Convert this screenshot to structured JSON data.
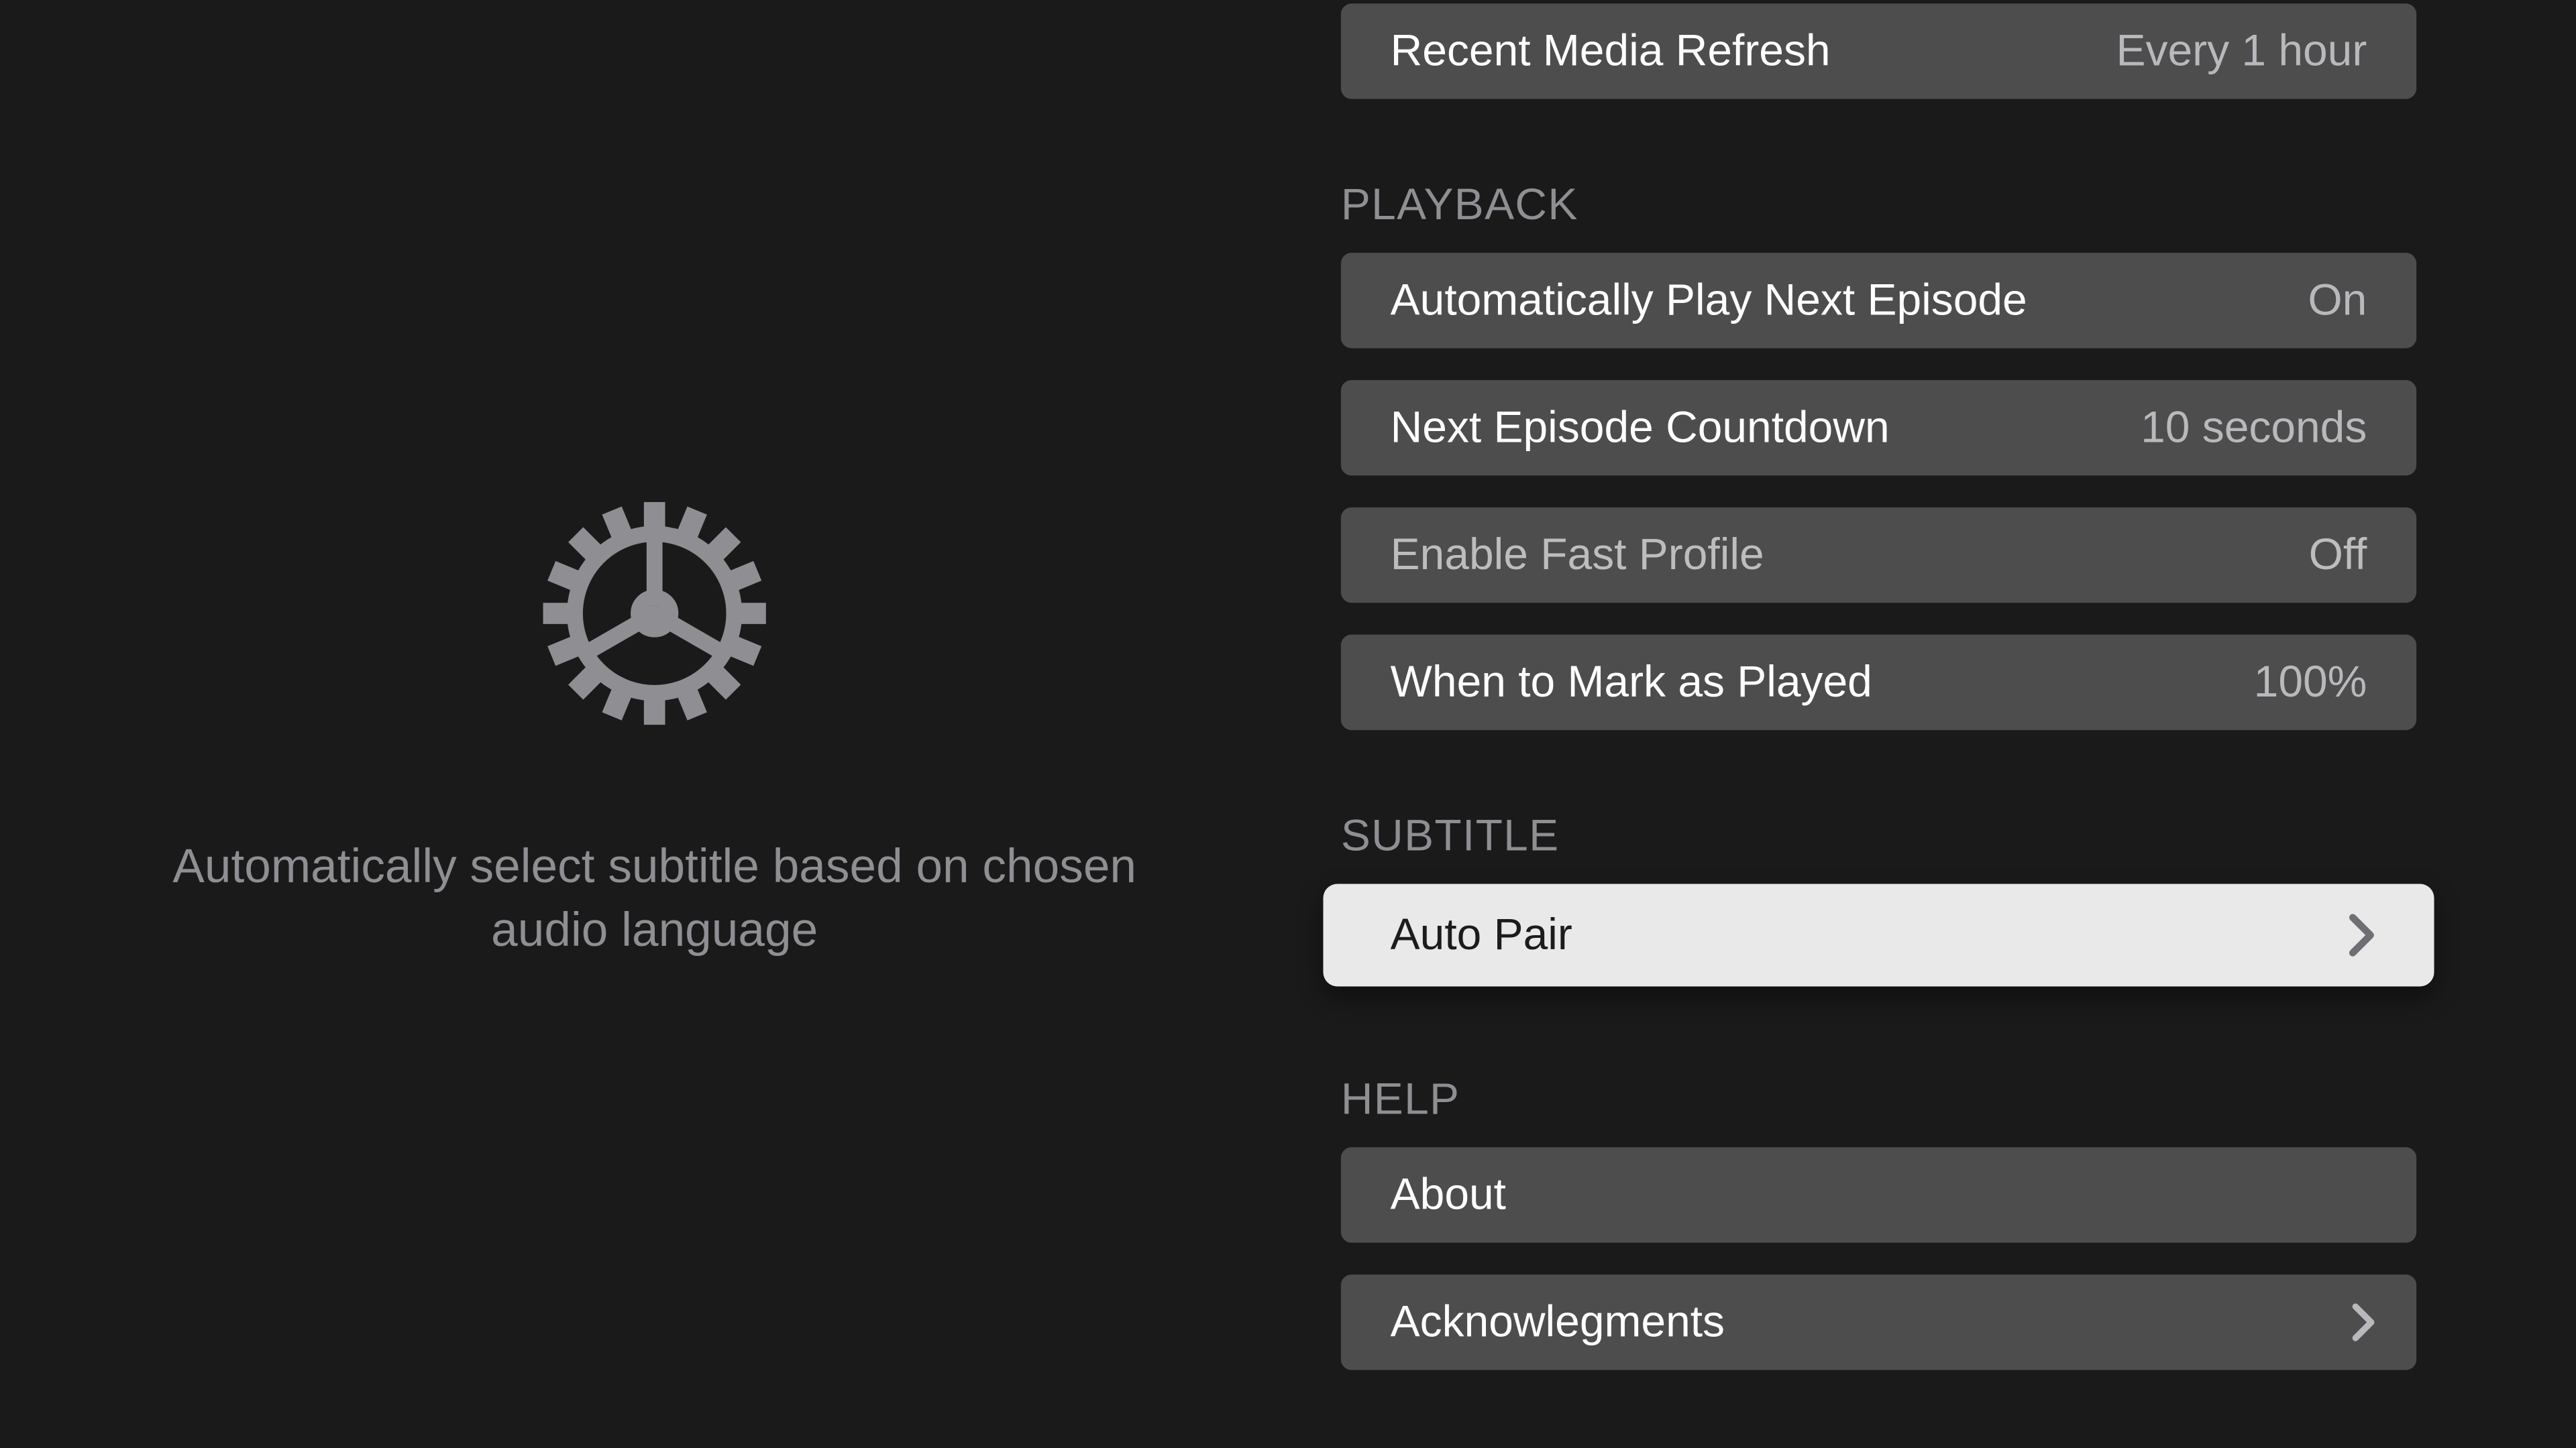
{
  "detail": {
    "description": "Automatically select subtitle based on chosen audio language"
  },
  "top": {
    "recent_media_refresh": {
      "label": "Recent Media Refresh",
      "value": "Every 1 hour"
    }
  },
  "sections": {
    "playback": {
      "header": "PLAYBACK",
      "auto_play_next": {
        "label": "Automatically Play Next Episode",
        "value": "On"
      },
      "next_countdown": {
        "label": "Next Episode Countdown",
        "value": "10 seconds"
      },
      "fast_profile": {
        "label": "Enable Fast Profile",
        "value": "Off"
      },
      "mark_played": {
        "label": "When to Mark as Played",
        "value": "100%"
      }
    },
    "subtitle": {
      "header": "SUBTITLE",
      "auto_pair": {
        "label": "Auto Pair"
      }
    },
    "help": {
      "header": "HELP",
      "about": {
        "label": "About"
      },
      "acknowledgments": {
        "label": "Acknowlegments"
      }
    }
  }
}
